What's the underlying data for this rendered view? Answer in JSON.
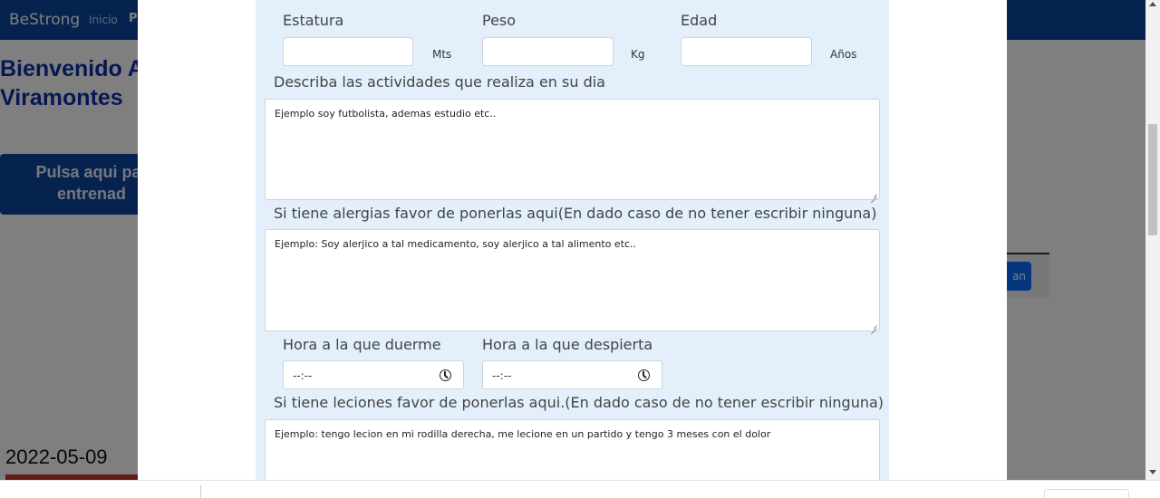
{
  "background": {
    "brand": "BeStrong",
    "nav_items": [
      "Inicio",
      "P"
    ],
    "welcome_line1": "Bienvenido A",
    "welcome_line2": "Viramontes",
    "train_button_line1": "Pulsa aqui par",
    "train_button_line2": "entrenad",
    "side_button": "an",
    "date": "2022-05-09"
  },
  "form": {
    "height_label": "Estatura",
    "height_unit": "Mts",
    "weight_label": "Peso",
    "weight_unit": "Kg",
    "age_label": "Edad",
    "age_unit": "Años",
    "activities_label": "Describa las actividades que realiza en su dia",
    "activities_placeholder": "Ejemplo soy futbolista, ademas estudio etc..",
    "allergies_label": "Si tiene alergias favor de ponerlas aqui(En dado caso de no tener escribir ninguna)",
    "allergies_placeholder": "Ejemplo: Soy alerjico a tal medicamento, soy alerjico a tal alimento etc..",
    "sleep_label": "Hora a la que duerme",
    "sleep_value": "--:--",
    "wake_label": "Hora a la que despierta",
    "wake_value": "--:--",
    "injuries_label": "Si tiene leciones favor de ponerlas aqui.(En dado caso de no tener escribir ninguna)",
    "injuries_placeholder": "Ejemplo: tengo lecion en mi rodilla derecha, me lecione en un partido y tengo 3 meses con el dolor"
  },
  "icons": {
    "time_picker": "clock-icon",
    "scroll_up": "arrow-up-icon",
    "scroll_down": "arrow-down-icon"
  },
  "colors": {
    "navbar": "#0d47a1",
    "form_background": "#e3f0fb",
    "welcome_text": "#0d2fa8"
  }
}
